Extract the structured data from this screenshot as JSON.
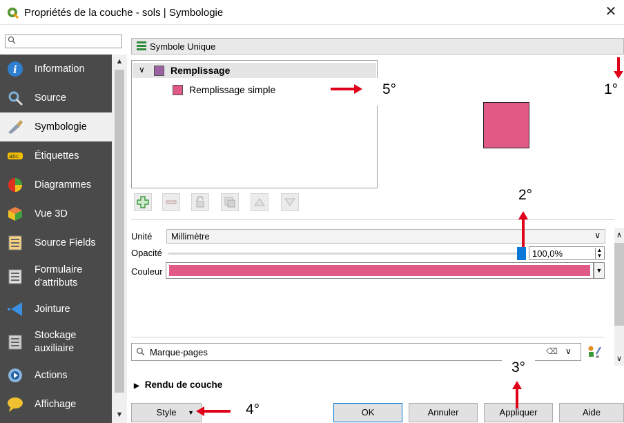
{
  "window": {
    "title": "Propriétés de la couche - sols | Symbologie",
    "close_glyph": "✕"
  },
  "sidebar": {
    "items": [
      {
        "label": "Information",
        "icon": "info-icon",
        "color": "#2f7fd0"
      },
      {
        "label": "Source",
        "icon": "source-wrench-icon",
        "color": "#7bb0d8"
      },
      {
        "label": "Symbologie",
        "icon": "paintbrush-icon",
        "color": "#c8a060"
      },
      {
        "label": "Étiquettes",
        "icon": "abc-label-icon",
        "color": "#f0c000"
      },
      {
        "label": "Diagrammes",
        "icon": "pie-chart-icon",
        "color": "#e03020"
      },
      {
        "label": "Vue 3D",
        "icon": "cube-3d-icon",
        "color": "#e04020"
      },
      {
        "label": "Source Fields",
        "icon": "fields-table-icon",
        "color": "#f4d080"
      },
      {
        "label": "Formulaire\nd'attributs",
        "icon": "form-icon",
        "color": "#dcdcdc"
      },
      {
        "label": "Jointure",
        "icon": "join-icon",
        "color": "#3a8fe0"
      },
      {
        "label": "Stockage\nauxiliaire",
        "icon": "database-icon",
        "color": "#cfcfcf"
      },
      {
        "label": "Actions",
        "icon": "gear-play-icon",
        "color": "#8ab4e0"
      },
      {
        "label": "Affichage",
        "icon": "speech-bubble-icon",
        "color": "#f0c030"
      }
    ],
    "active_index": 2
  },
  "renderer": {
    "label": "Symbole Unique"
  },
  "symbol_tree": {
    "root_label": "Remplissage",
    "child_label": "Remplissage simple",
    "root_swatch_color": "#9a62a0",
    "fill_color": "#e05a85"
  },
  "properties": {
    "unit_label": "Unité",
    "unit_value": "Millimètre",
    "opacity_label": "Opacité",
    "opacity_value": "100,0%",
    "opacity_fraction": 1.0,
    "color_label": "Couleur"
  },
  "bookmarks": {
    "placeholder": "Marque-pages"
  },
  "render_section": {
    "label": "Rendu de couche"
  },
  "buttons": {
    "style": "Style",
    "ok": "OK",
    "cancel": "Annuler",
    "apply": "Appliquer",
    "help": "Aide"
  },
  "annotations": {
    "a1": "1°",
    "a2": "2°",
    "a3": "3°",
    "a4": "4°",
    "a5": "5°",
    "arrow_color": "#e0001a"
  }
}
